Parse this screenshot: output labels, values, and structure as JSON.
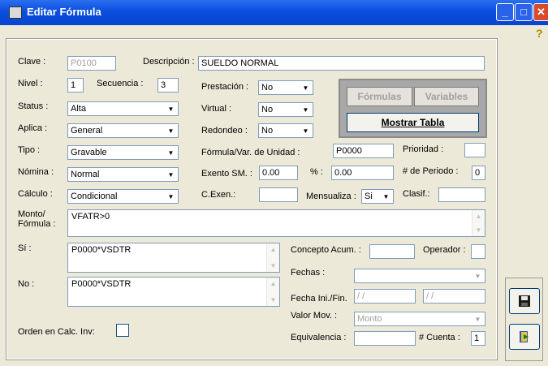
{
  "window": {
    "title": "Editar Fórmula",
    "minimize": "_",
    "maximize": "□",
    "close": "✕",
    "help_icon": "question-icon"
  },
  "labels": {
    "clave": "Clave :",
    "descripcion": "Descripción :",
    "nivel": "Nivel :",
    "secuencia": "Secuencia :",
    "status": "Status :",
    "aplica": "Aplica :",
    "tipo": "Tipo :",
    "nomina": "Nómina :",
    "calculo": "Cálculo :",
    "monto": "Monto/\nFórmula :",
    "si": "Sí :",
    "no": "No :",
    "orden": "Orden en Calc. Inv:",
    "prestacion": "Prestación :",
    "virtual": "Virtual :",
    "redondeo": "Redondeo :",
    "formula_unidad": "Fórmula/Var. de Unidad :",
    "prioridad": "Prioridad :",
    "exento": "Exento SM. :",
    "pct": "% :",
    "num_periodo": "# de Periodo :",
    "cexen": "C.Exen.:",
    "mensualiza": "Mensualiza :",
    "clasif": "Clasif.:",
    "concepto_acum": "Concepto Acum. :",
    "operador": "Operador :",
    "fechas": "Fechas :",
    "fecha_ini_fin": "Fecha Ini./Fin.",
    "valor_mov": "Valor Mov. :",
    "equivalencia": "Equivalencia :",
    "num_cuenta": "# Cuenta :"
  },
  "values": {
    "clave": "P0100",
    "descripcion": "SUELDO NORMAL",
    "nivel": "1",
    "secuencia": "3",
    "status": "Alta",
    "aplica": "General",
    "tipo": "Gravable",
    "nomina": "Normal",
    "calculo": "Condicional",
    "prestacion": "No",
    "virtual": "No",
    "redondeo": "No",
    "formula_unidad": "P0000",
    "prioridad": "",
    "exento": "0.00",
    "pct": "0.00",
    "num_periodo": "0",
    "cexen": "",
    "mensualiza": "Si",
    "clasif": "",
    "monto": "VFATR>0",
    "si": "P0000*VSDTR",
    "no": "P0000*VSDTR",
    "concepto_acum": "",
    "operador": "",
    "fechas": "",
    "fecha_ini": " / /",
    "fecha_fin": " / /",
    "valor_mov": "Monto",
    "equivalencia": "",
    "num_cuenta": "1",
    "orden_checked": false
  },
  "buttons": {
    "formulas": "Fórmulas",
    "variables": "Variables",
    "mostrar_tabla": "Mostrar Tabla",
    "save_icon": "floppy-disk-icon",
    "exit_icon": "exit-door-icon"
  },
  "icons": {
    "combo_arrow": "▼",
    "scroll_up": "▲",
    "scroll_down": "▼"
  }
}
